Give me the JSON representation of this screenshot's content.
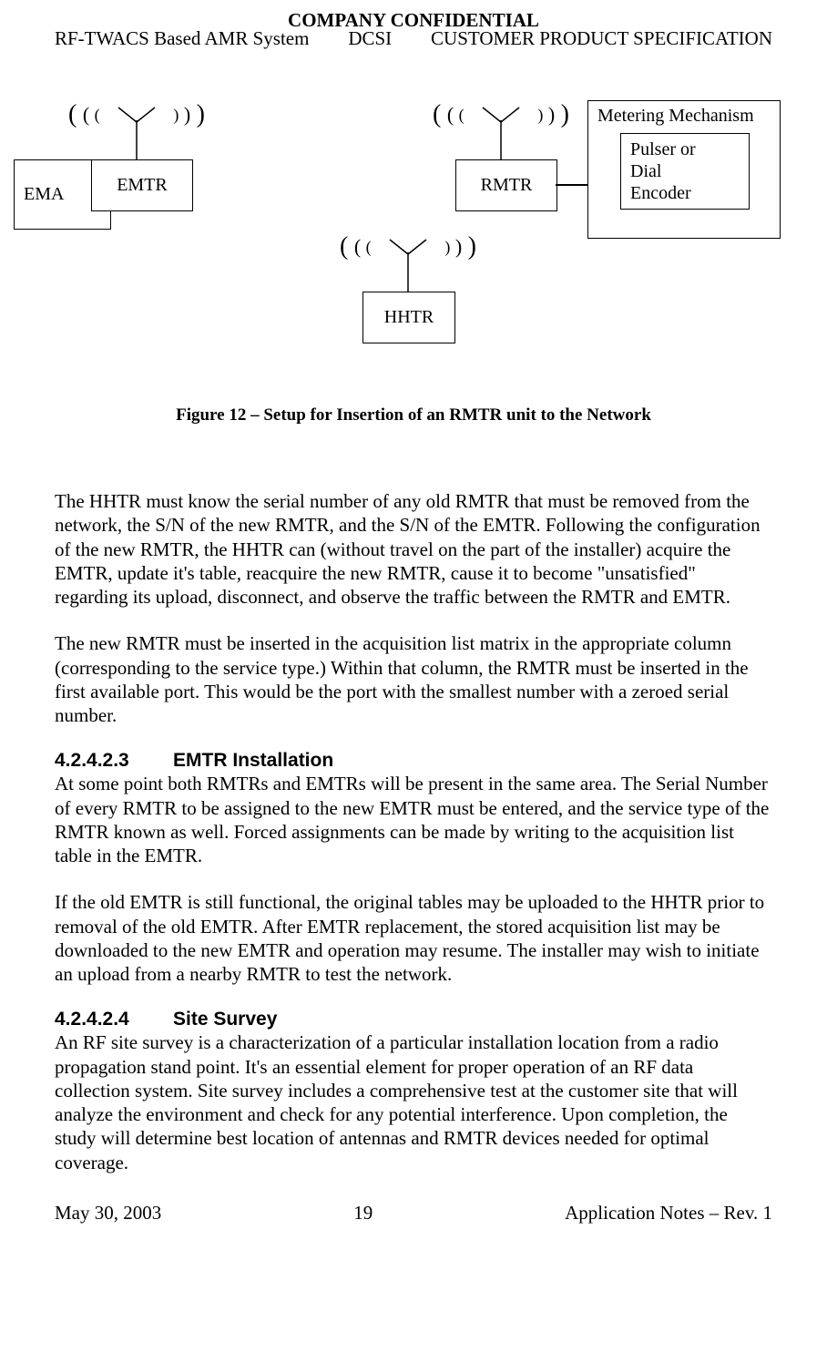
{
  "header": {
    "confidential": "COMPANY CONFIDENTIAL",
    "left": "RF-TWACS Based AMR System",
    "center": "DCSI",
    "right": "CUSTOMER PRODUCT SPECIFICATION"
  },
  "diagram": {
    "ema": "EMA",
    "emtr": "EMTR",
    "rmtr": "RMTR",
    "hhtr": "HHTR",
    "metering_label": "Metering Mechanism",
    "pulser_line1": "Pulser or",
    "pulser_line2": "Dial",
    "pulser_line3": "Encoder"
  },
  "figure_caption": "Figure 12 – Setup for Insertion of an RMTR unit to the Network",
  "para1": "The HHTR must know the serial number of any old RMTR that must be removed from the network, the S/N of the new RMTR, and the S/N of the EMTR. Following the configuration of the new RMTR, the HHTR can (without travel on the part of the installer) acquire the EMTR, update it's table, reacquire the new RMTR, cause it to become \"unsatisfied\" regarding its upload, disconnect, and observe the traffic between the RMTR and EMTR.",
  "para2": "The new RMTR must be inserted in the acquisition list matrix in the appropriate column (corresponding to the service type.) Within that column, the RMTR must be inserted in the first available port. This would be the port with the smallest number with a zeroed serial number.",
  "section1": {
    "num": "4.2.4.2.3",
    "title": "EMTR Installation"
  },
  "para3": "At some point both RMTRs and EMTRs will be present in the same area. The Serial Number of every RMTR to be assigned to the new EMTR must be entered, and the service type of the RMTR known as well. Forced assignments can be made by writing to the acquisition list table in the EMTR.",
  "para4": "If the old EMTR is still functional, the original tables may be uploaded to the HHTR prior to removal of the old EMTR. After EMTR replacement, the stored acquisition list may be downloaded to the new EMTR and operation may resume. The installer may wish to initiate an upload from a nearby RMTR to test the network.",
  "section2": {
    "num": "4.2.4.2.4",
    "title": "Site Survey"
  },
  "para5": "An RF site survey is a characterization of a particular installation location from a radio propagation stand point. It's an essential element for proper operation of an RF data collection system. Site survey includes a comprehensive test at the customer site that will analyze the environment and check for any potential interference. Upon completion, the study will determine best location of antennas and RMTR devices needed for optimal coverage.",
  "footer": {
    "left": "May 30, 2003",
    "center": "19",
    "right": "Application Notes – Rev. 1"
  }
}
